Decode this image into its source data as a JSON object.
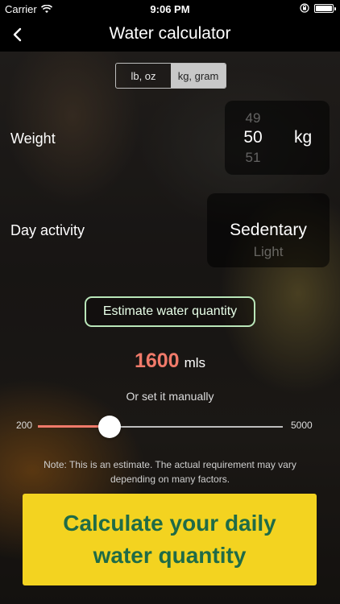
{
  "status": {
    "carrier": "Carrier",
    "time": "9:06 PM"
  },
  "nav": {
    "back_icon": "chevron-left-icon",
    "title": "Water calculator"
  },
  "units": {
    "options": [
      "lb, oz",
      "kg, gram"
    ],
    "selected": "kg, gram"
  },
  "weight": {
    "label": "Weight",
    "prev": "49",
    "value": "50",
    "next": "51",
    "unit": "kg"
  },
  "activity": {
    "label": "Day activity",
    "value": "Sedentary",
    "next": "Light"
  },
  "estimate_button": "Estimate water quantity",
  "quantity": {
    "value": "1600",
    "unit": "mls"
  },
  "manual_label": "Or set it manually",
  "slider": {
    "min_label": "200",
    "max_label": "5000",
    "min": 200,
    "max": 5000,
    "value": 1600,
    "accent": "#f07a6a"
  },
  "note": "Note: This is an estimate. The actual requirement may vary depending on many factors.",
  "calculate_button": "Calculate your daily water quantity",
  "colors": {
    "button_bg": "#f3d320",
    "button_text": "#1f6b47",
    "estimate_border": "#b9e6b9"
  }
}
